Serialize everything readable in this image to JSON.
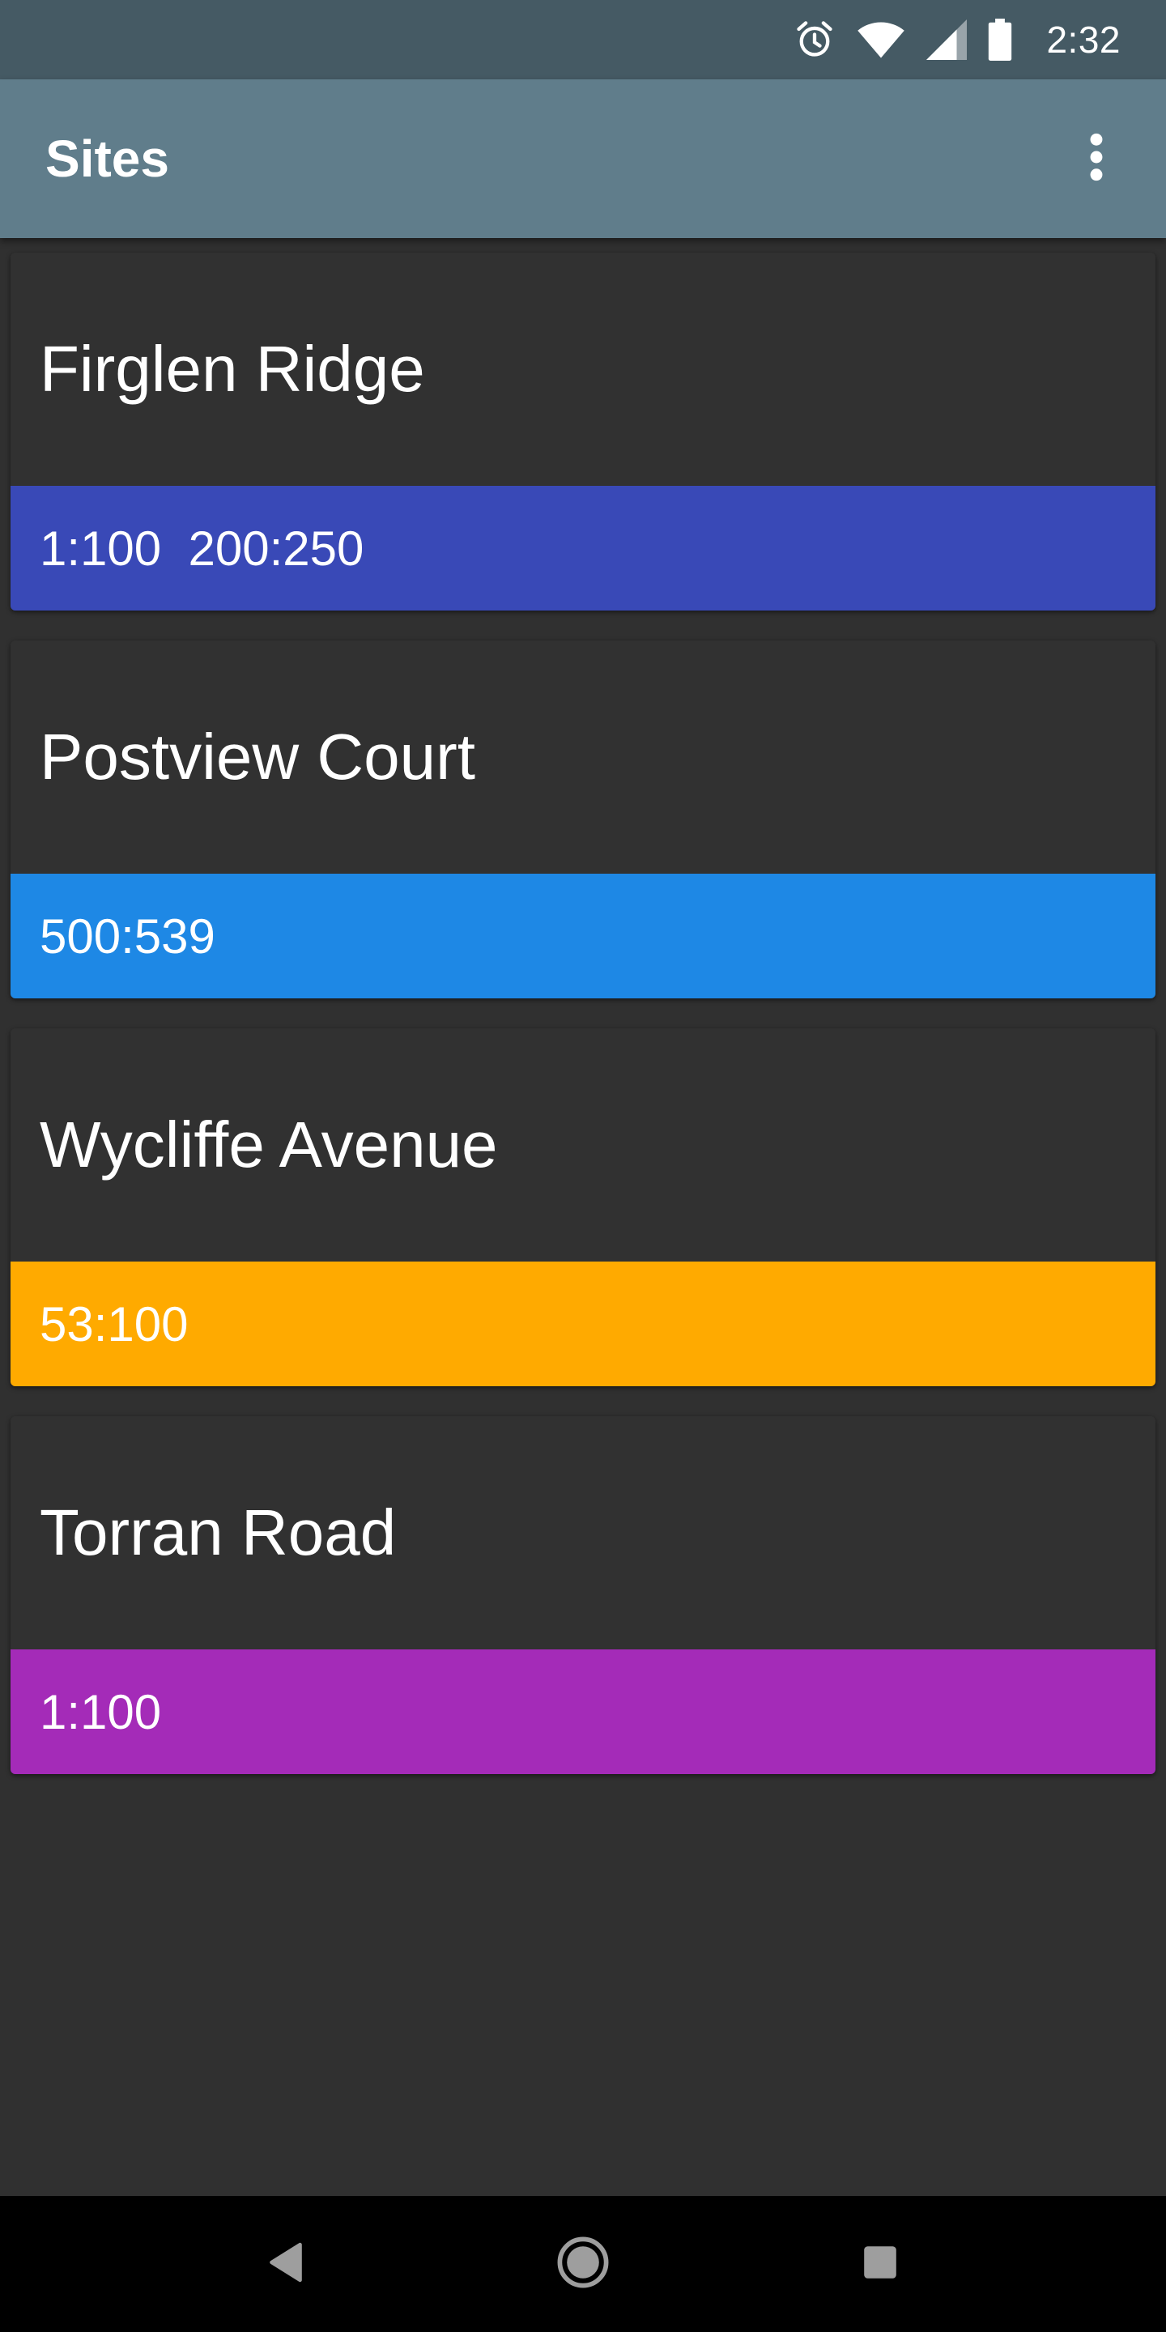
{
  "status_bar": {
    "time": "2:32",
    "icons": [
      "alarm-icon",
      "wifi-icon",
      "cell-signal-icon",
      "battery-icon"
    ]
  },
  "app_bar": {
    "title": "Sites",
    "overflow_icon": "more-vert-icon"
  },
  "sites": [
    {
      "name": "Firglen Ridge",
      "ranges": "1:100  200:250",
      "color": "#3949b7"
    },
    {
      "name": "Postview Court",
      "ranges": "500:539",
      "color": "#1e88e5"
    },
    {
      "name": "Wycliffe Avenue",
      "ranges": "53:100",
      "color": "#ffaa00"
    },
    {
      "name": "Torran Road",
      "ranges": "1:100",
      "color": "#a42bb8"
    }
  ],
  "nav_bar": {
    "buttons": [
      "back-icon",
      "home-icon",
      "recents-icon"
    ]
  },
  "colors": {
    "status_bar": "#455a64",
    "app_bar": "#607d8b",
    "background": "#303030"
  }
}
